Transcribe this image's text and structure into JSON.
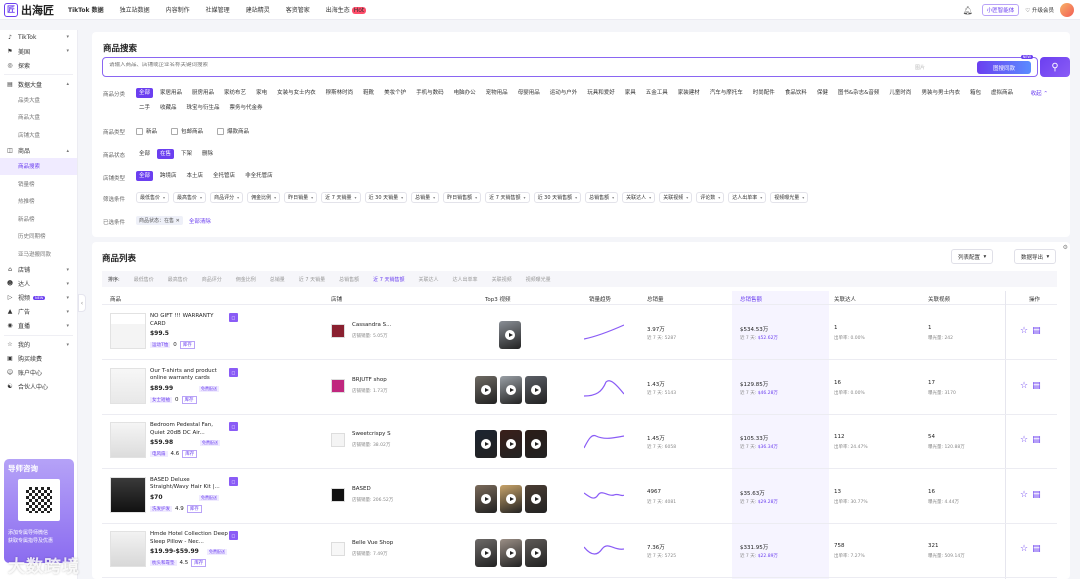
{
  "topbar": {
    "logo_icon": "匠",
    "logo_text": "出海匠",
    "nav": [
      "TikTok 数据",
      "独立站数据",
      "内容制作",
      "社媒管理",
      "建站精灵",
      "客资管家",
      "出海生态"
    ],
    "hot_badge": "Hot",
    "mini_app": "小匠智能体",
    "upgrade": "升级会员"
  },
  "sidebar": {
    "platform": "TikTok",
    "region": "美国",
    "explore": "探索",
    "groups": [
      {
        "label": "数据大盘",
        "subs": [
          "品类大盘",
          "商品大盘",
          "店铺大盘"
        ]
      },
      {
        "label": "商品",
        "subs": [
          "商品搜索",
          "销量榜",
          "热推榜",
          "新品榜",
          "历史同期榜",
          "亚马逊搬同款"
        ]
      }
    ],
    "more": [
      "店铺",
      "达人",
      "视频",
      "广告",
      "直播"
    ],
    "video_badge": "NEW",
    "bottom": [
      "我的",
      "购买续费",
      "账户中心",
      "合伙人中心"
    ],
    "promo_title": "导师咨询",
    "promo_line1": "添加专属导师微信",
    "promo_line2": "获取专属指导及优惠",
    "collapse": "‹"
  },
  "search": {
    "title": "商品搜索",
    "placeholder": "请输入商品、店铺或企业名称关键词搜索",
    "img_label": "图片",
    "img_button": "图搜同款",
    "new": "NEW",
    "category_label": "商品分类",
    "categories": [
      "全部",
      "家居用品",
      "厨房用品",
      "家纺布艺",
      "家电",
      "女装与女士内衣",
      "穆斯林时尚",
      "鞋靴",
      "美妆个护",
      "手机与数码",
      "电脑办公",
      "宠物用品",
      "母婴用品",
      "运动与户外",
      "玩具和爱好",
      "家具",
      "五金工具",
      "家装建材",
      "汽车与摩托车",
      "时尚配件",
      "食品饮料",
      "保健",
      "图书&杂志&音频",
      "儿童时尚",
      "男装与男士内衣",
      "箱包",
      "虚拟商品",
      "二手",
      "收藏品",
      "珠宝与衍生品",
      "票务与代金券"
    ],
    "collapse_link": "收起",
    "type_label": "商品类型",
    "types": [
      "新品",
      "包邮商品",
      "爆款商品"
    ],
    "status_label": "商品状态",
    "statuses": [
      "全部",
      "在售",
      "下架",
      "删除"
    ],
    "shop_type_label": "店铺类型",
    "shop_types": [
      "全部",
      "跨境店",
      "本土店",
      "全托管店",
      "非全托管店"
    ],
    "filter_label": "筛选条件",
    "filters": [
      "最低售价",
      "最高售价",
      "商品评分",
      "佣金比例",
      "昨日销量",
      "近 7 天销量",
      "近 30 天销量",
      "总销量",
      "昨日销售额",
      "近 7 天销售额",
      "近 30 天销售额",
      "总销售额",
      "关联达人",
      "关联视频",
      "评论数",
      "达人出单率",
      "视频曝光量"
    ],
    "selected_label": "已选条件",
    "selected_tag": "商品状态：在售",
    "clear_all": "全部清除"
  },
  "list": {
    "title": "商品列表",
    "config_button": "列表配置",
    "export_button": "数据导出",
    "sort_label": "排序:",
    "sort_items": [
      "最低售价",
      "最高售价",
      "商品评分",
      "佣金比例",
      "总销量",
      "近 7 天销量",
      "总销售额",
      "近 7 天销售额",
      "关联达人",
      "达人出单率",
      "关联视频",
      "视频曝光量"
    ],
    "columns": [
      "商品",
      "店铺",
      "Top3 视频",
      "销量趋势",
      "总销量",
      "总销售额",
      "关联达人",
      "关联视频",
      "操作"
    ],
    "rows": [
      {
        "name": "NO GIFT !!! WARRANTY CARD",
        "price": "$99.5",
        "tag": "运动T恤",
        "num": "0",
        "stock": "库存",
        "shop": "Cassandra S...",
        "shop_sales": "店铺销量: 5.05万",
        "total_sales": "3.97万",
        "sales_7d": "近 7 天:  5287",
        "revenue": "$534.53万",
        "rev_7d": "$52.62万",
        "creators": "1",
        "rate": "出单率:  0.00%",
        "videos": "1",
        "exposure": "曝光量:  242"
      },
      {
        "name": "Our T-shirts and product online warranty cards",
        "price": "$89.99",
        "tag": "女士短袖",
        "num": "0",
        "stock": "库存",
        "shop": "BRJUTF shop",
        "shop_sales": "店铺销量: 1.73万",
        "total_sales": "1.43万",
        "sales_7d": "近 7 天:  5143",
        "revenue": "$129.85万",
        "rev_7d": "$46.28万",
        "creators": "16",
        "rate": "出单率:  0.00%",
        "videos": "17",
        "exposure": "曝光量:  3170"
      },
      {
        "name": "Bedroom Pedestal Fan, Quiet 20dB DC Air...",
        "price": "$59.98",
        "tag": "电风扇",
        "num": "4.6",
        "stock": "库存",
        "shop": "Sweetcrispy S",
        "shop_sales": "店铺销量: 38.02万",
        "total_sales": "1.45万",
        "sales_7d": "近 7 天:  6058",
        "revenue": "$105.33万",
        "rev_7d": "$36.34万",
        "creators": "112",
        "rate": "出单率:  24.47%",
        "videos": "54",
        "exposure": "曝光量:  120.88万"
      },
      {
        "name": "BASED Deluxe Straight/Wavy Hair Kit |...",
        "price": "$70",
        "tag": "洗发护发",
        "num": "4.9",
        "stock": "库存",
        "shop": "BASED",
        "shop_sales": "店铺销量: 206.52万",
        "total_sales": "4967",
        "sales_7d": "近 7 天:  4081",
        "revenue": "$35.63万",
        "rev_7d": "$29.28万",
        "creators": "13",
        "rate": "出单率:  30.77%",
        "videos": "16",
        "exposure": "曝光量:  4.44万"
      },
      {
        "name": "Hmde Hotel Collection Deep Sleep Pillow - Nec...",
        "price": "$19.99-$59.99",
        "tag": "枕头和靠垫",
        "num": "4.5",
        "stock": "库存",
        "shop": "Belle Vue Shop",
        "shop_sales": "店铺销量: 7.49万",
        "total_sales": "7.36万",
        "sales_7d": "近 7 天:  5725",
        "revenue": "$331.95万",
        "rev_7d": "$22.89万",
        "creators": "758",
        "rate": "出单率:  7.27%",
        "videos": "321",
        "exposure": "曝光量:  509.14万"
      }
    ],
    "free_ship": "免费配送",
    "rev_prefix": "近 7 天:"
  },
  "watermark": "大数跨境",
  "colors": {
    "accent": "#6b3ff0",
    "hot": "#ff4d6a"
  }
}
